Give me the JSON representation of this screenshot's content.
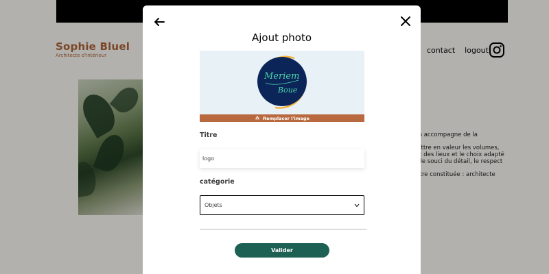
{
  "site": {
    "logo_name": "Sophie Bluel",
    "logo_subtitle": "Architecte d'intérieur",
    "nav": [
      "contact",
      "logout"
    ],
    "about_lines": [
      "ous accompagne de la",
      "mettre en valeur les volumes,",
      "prit des lieux et le choix adapté",
      "ns le souci du détail, le respect",
      "t-être constituée : architecte"
    ]
  },
  "modal": {
    "title": "Ajout photo",
    "replace_label": "Remplacer l'image",
    "title_label": "Titre",
    "title_value": "logo",
    "category_label": "catégorie",
    "category_value": "Objets",
    "submit_label": "Valider"
  },
  "preview_logo_text": [
    "Meriem",
    "Boue"
  ],
  "colors": {
    "brand": "#B1663C",
    "submit": "#1D6154",
    "replace_bar": "#B8693F",
    "preview_bg": "#E8F1F6",
    "logo_circle": "#0B2559",
    "logo_ring": "#F2B33D",
    "logo_script": "#4ED1A8"
  },
  "icons": [
    "back-arrow-icon",
    "close-icon",
    "instagram-icon",
    "recycle-icon",
    "chevron-down-icon"
  ]
}
